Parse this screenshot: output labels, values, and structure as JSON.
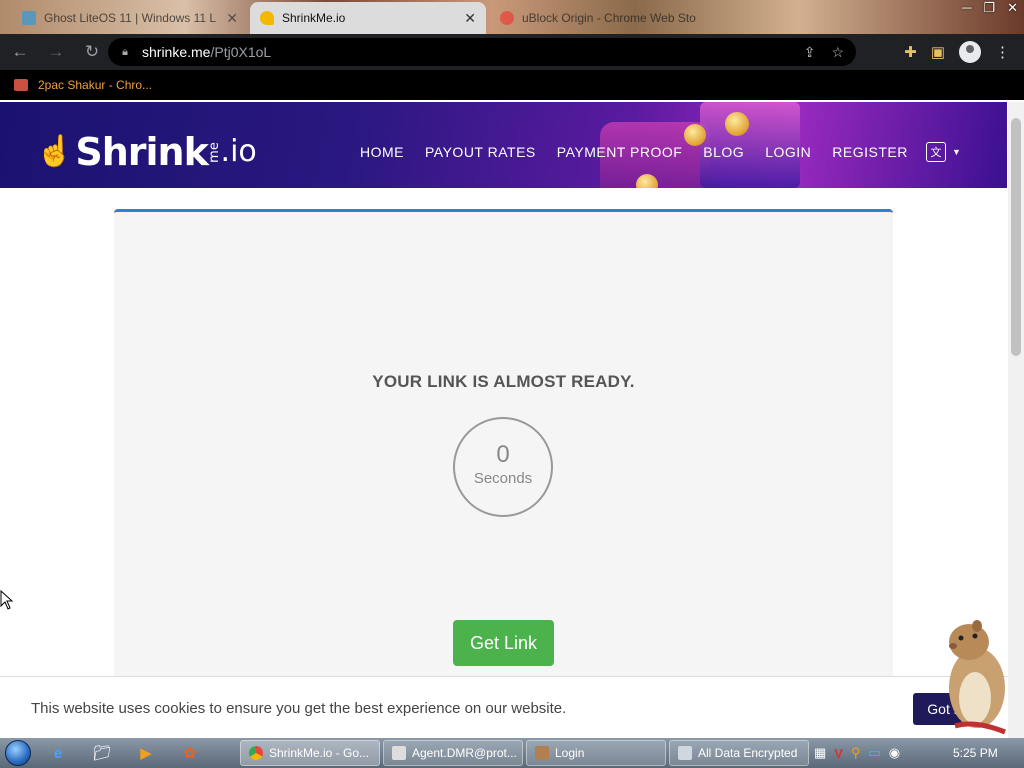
{
  "browser": {
    "tabs": [
      {
        "title": "Ghost LiteOS 11 | Windows 11 L",
        "active": false
      },
      {
        "title": "ShrinkMe.io",
        "active": true
      },
      {
        "title": "uBlock Origin - Chrome Web Sto",
        "active": false
      }
    ],
    "url_host": "shrinke.me",
    "url_path": "/Ptj0X1oL",
    "bookmark": "2pac Shakur - Chro..."
  },
  "site": {
    "logo_text": "Shrink",
    "logo_me": "me",
    "logo_io": ".io",
    "nav": [
      "HOME",
      "PAYOUT RATES",
      "PAYMENT PROOF",
      "BLOG",
      "LOGIN",
      "REGISTER"
    ]
  },
  "card": {
    "title": "YOUR LINK IS ALMOST READY.",
    "timer_value": "0",
    "timer_unit": "Seconds",
    "button": "Get Link"
  },
  "cookie": {
    "message": "This website uses cookies to ensure you get the best experience on our website.",
    "button": "Got it"
  },
  "taskbar": {
    "items": [
      "ShrinkMe.io - Go...",
      "Agent.DMR@prot...",
      "Login",
      "All Data Encrypted"
    ],
    "clock": "5:25 PM"
  },
  "colors": {
    "accent_blue": "#2e7fd0",
    "button_green": "#4cb24c",
    "cookie_button": "#1f1a5a",
    "logo_yellow": "#f5b800"
  }
}
